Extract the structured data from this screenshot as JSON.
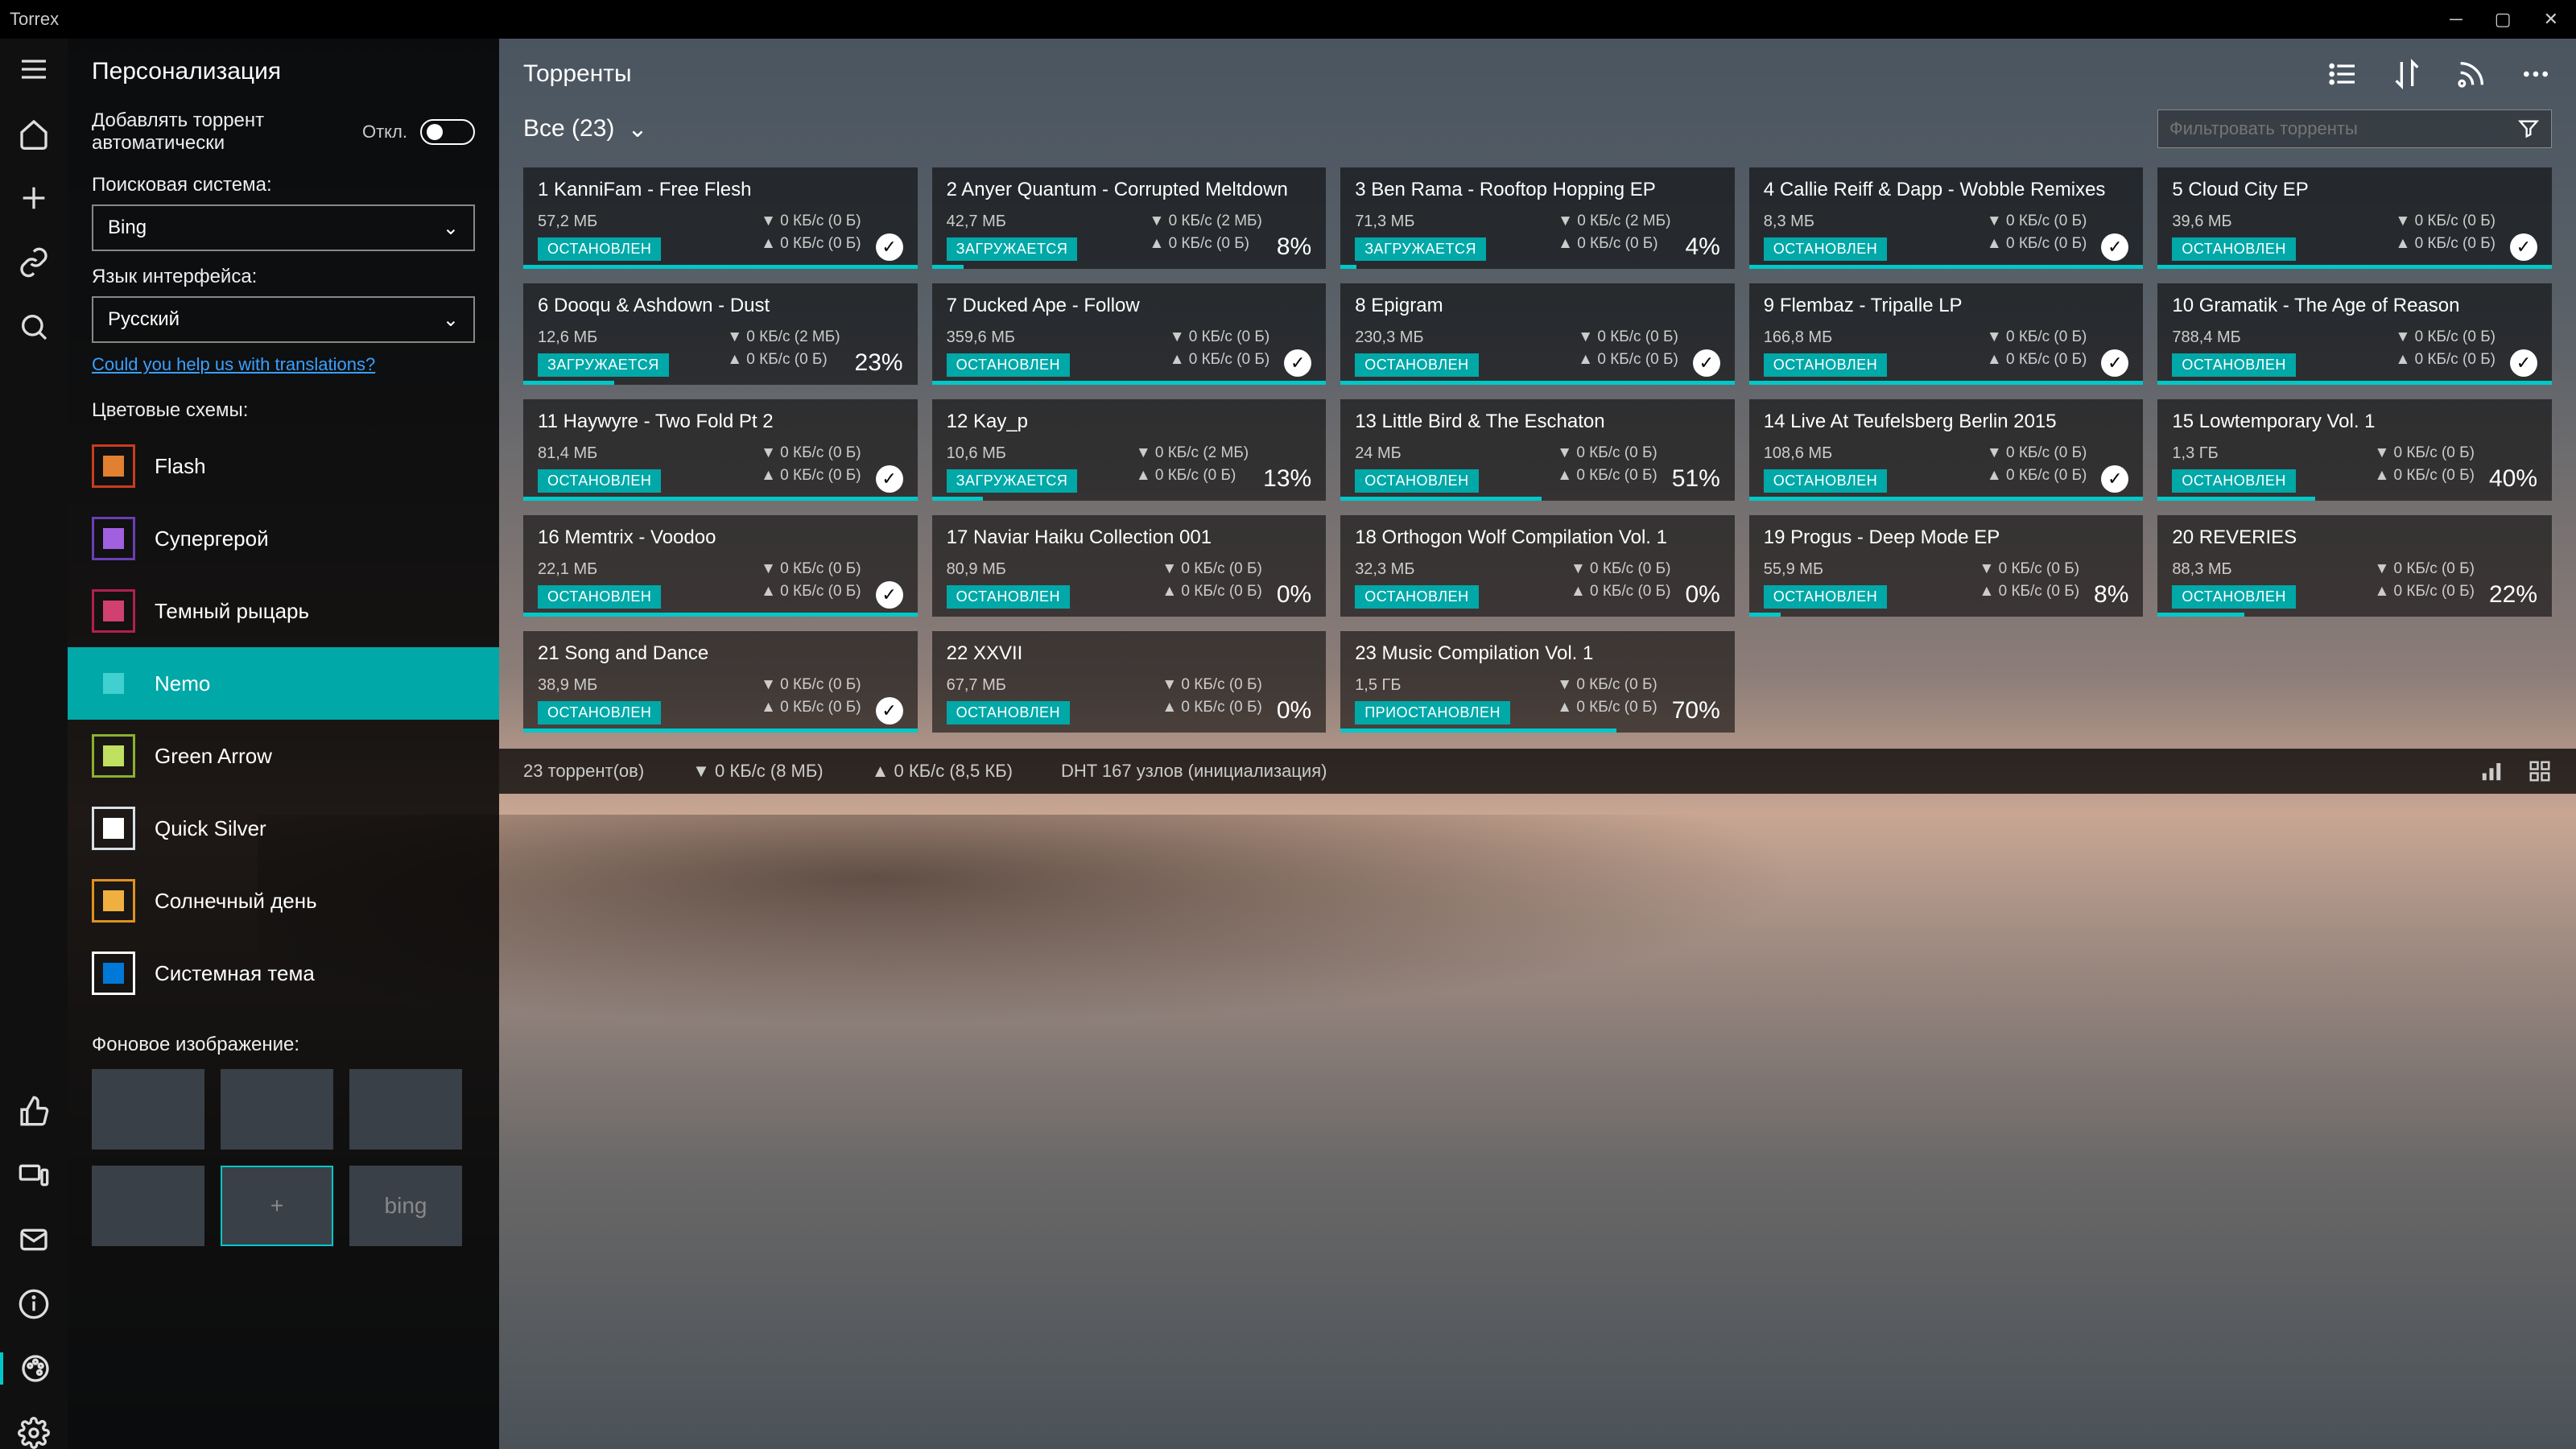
{
  "app_title": "Torrex",
  "sidebar": {
    "title": "Персонализация",
    "auto_add_label": "Добавлять торрент автоматически",
    "auto_add_state": "Откл.",
    "search_engine_label": "Поисковая система:",
    "search_engine_value": "Bing",
    "lang_label": "Язык интерфейса:",
    "lang_value": "Русский",
    "translate_link": "Could you help us with translations?",
    "themes_label": "Цветовые схемы:",
    "themes": [
      {
        "name": "Flash",
        "outer": "#c83c1e",
        "inner": "#e08030"
      },
      {
        "name": "Супергерой",
        "outer": "#6a3fb5",
        "inner": "#a060e0"
      },
      {
        "name": "Темный рыцарь",
        "outer": "#b02050",
        "inner": "#d04070"
      },
      {
        "name": "Nemo",
        "outer": "#00a8a8",
        "inner": "#40d0d0",
        "selected": true
      },
      {
        "name": "Green Arrow",
        "outer": "#8ab030",
        "inner": "#c0e060"
      },
      {
        "name": "Quick Silver",
        "outer": "#d8e0e8",
        "inner": "#ffffff"
      },
      {
        "name": "Солнечный день",
        "outer": "#e09020",
        "inner": "#f0b040"
      },
      {
        "name": "Системная тема",
        "outer": "#ffffff",
        "inner": "#0078d7"
      }
    ],
    "bg_label": "Фоновое изображение:",
    "bg_tiles": [
      "",
      "",
      "",
      "",
      "+",
      "bing"
    ],
    "bg_selected_index": 4
  },
  "content": {
    "title": "Торренты",
    "filter_label": "Все (23)",
    "search_placeholder": "Фильтровать торренты"
  },
  "status_labels": {
    "stopped": "ОСТАНОВЛЕН",
    "downloading": "ЗАГРУЖАЕТСЯ",
    "paused": "ПРИОСТАНОВЛЕН"
  },
  "torrents": [
    {
      "n": 1,
      "name": "KanniFam - Free Flesh",
      "size": "57,2 МБ",
      "status": "stopped",
      "down": "0 КБ/с (0 Б)",
      "up": "0 КБ/с (0 Б)",
      "done": true,
      "pct": null,
      "bar": 100
    },
    {
      "n": 2,
      "name": "Anyer Quantum - Corrupted Meltdown",
      "size": "42,7 МБ",
      "status": "downloading",
      "down": "0 КБ/с (2 МБ)",
      "up": "0 КБ/с (0 Б)",
      "pct": "8%",
      "bar": 8
    },
    {
      "n": 3,
      "name": "Ben Rama - Rooftop Hopping EP",
      "size": "71,3 МБ",
      "status": "downloading",
      "down": "0 КБ/с (2 МБ)",
      "up": "0 КБ/с (0 Б)",
      "pct": "4%",
      "bar": 4
    },
    {
      "n": 4,
      "name": "Callie Reiff & Dapp - Wobble Remixes",
      "size": "8,3 МБ",
      "status": "stopped",
      "down": "0 КБ/с (0 Б)",
      "up": "0 КБ/с (0 Б)",
      "done": true,
      "pct": null,
      "bar": 100
    },
    {
      "n": 5,
      "name": "Cloud City EP",
      "size": "39,6 МБ",
      "status": "stopped",
      "down": "0 КБ/с (0 Б)",
      "up": "0 КБ/с (0 Б)",
      "done": true,
      "pct": null,
      "bar": 100
    },
    {
      "n": 6,
      "name": "Dooqu & Ashdown - Dust",
      "size": "12,6 МБ",
      "status": "downloading",
      "down": "0 КБ/с (2 МБ)",
      "up": "0 КБ/с (0 Б)",
      "pct": "23%",
      "bar": 23
    },
    {
      "n": 7,
      "name": "Ducked Ape - Follow",
      "size": "359,6 МБ",
      "status": "stopped",
      "down": "0 КБ/с (0 Б)",
      "up": "0 КБ/с (0 Б)",
      "done": true,
      "pct": null,
      "bar": 100
    },
    {
      "n": 8,
      "name": "Epigram",
      "size": "230,3 МБ",
      "status": "stopped",
      "down": "0 КБ/с (0 Б)",
      "up": "0 КБ/с (0 Б)",
      "done": true,
      "pct": null,
      "bar": 100
    },
    {
      "n": 9,
      "name": "Flembaz - Tripalle LP",
      "size": "166,8 МБ",
      "status": "stopped",
      "down": "0 КБ/с (0 Б)",
      "up": "0 КБ/с (0 Б)",
      "done": true,
      "pct": null,
      "bar": 100
    },
    {
      "n": 10,
      "name": "Gramatik - The Age of Reason",
      "size": "788,4 МБ",
      "status": "stopped",
      "down": "0 КБ/с (0 Б)",
      "up": "0 КБ/с (0 Б)",
      "done": true,
      "pct": null,
      "bar": 100
    },
    {
      "n": 11,
      "name": "Haywyre - Two Fold Pt 2",
      "size": "81,4 МБ",
      "status": "stopped",
      "down": "0 КБ/с (0 Б)",
      "up": "0 КБ/с (0 Б)",
      "done": true,
      "pct": null,
      "bar": 100
    },
    {
      "n": 12,
      "name": "Kay_p",
      "size": "10,6 МБ",
      "status": "downloading",
      "down": "0 КБ/с (2 МБ)",
      "up": "0 КБ/с (0 Б)",
      "pct": "13%",
      "bar": 13
    },
    {
      "n": 13,
      "name": "Little Bird & The Eschaton",
      "size": "24 МБ",
      "status": "stopped",
      "down": "0 КБ/с (0 Б)",
      "up": "0 КБ/с (0 Б)",
      "pct": "51%",
      "bar": 51
    },
    {
      "n": 14,
      "name": "Live At Teufelsberg Berlin 2015",
      "size": "108,6 МБ",
      "status": "stopped",
      "down": "0 КБ/с (0 Б)",
      "up": "0 КБ/с (0 Б)",
      "done": true,
      "pct": null,
      "bar": 100
    },
    {
      "n": 15,
      "name": "Lowtemporary Vol. 1",
      "size": "1,3 ГБ",
      "status": "stopped",
      "down": "0 КБ/с (0 Б)",
      "up": "0 КБ/с (0 Б)",
      "pct": "40%",
      "bar": 40
    },
    {
      "n": 16,
      "name": "Memtrix - Voodoo",
      "size": "22,1 МБ",
      "status": "stopped",
      "down": "0 КБ/с (0 Б)",
      "up": "0 КБ/с (0 Б)",
      "done": true,
      "pct": null,
      "bar": 100
    },
    {
      "n": 17,
      "name": "Naviar Haiku Collection 001",
      "size": "80,9 МБ",
      "status": "stopped",
      "down": "0 КБ/с (0 Б)",
      "up": "0 КБ/с (0 Б)",
      "pct": "0%",
      "bar": 0
    },
    {
      "n": 18,
      "name": "Orthogon Wolf Compilation Vol. 1",
      "size": "32,3 МБ",
      "status": "stopped",
      "down": "0 КБ/с (0 Б)",
      "up": "0 КБ/с (0 Б)",
      "pct": "0%",
      "bar": 0
    },
    {
      "n": 19,
      "name": "Progus - Deep Mode EP",
      "size": "55,9 МБ",
      "status": "stopped",
      "down": "0 КБ/с (0 Б)",
      "up": "0 КБ/с (0 Б)",
      "pct": "8%",
      "bar": 8
    },
    {
      "n": 20,
      "name": "REVERIES",
      "size": "88,3 МБ",
      "status": "stopped",
      "down": "0 КБ/с (0 Б)",
      "up": "0 КБ/с (0 Б)",
      "pct": "22%",
      "bar": 22
    },
    {
      "n": 21,
      "name": "Song and Dance",
      "size": "38,9 МБ",
      "status": "stopped",
      "down": "0 КБ/с (0 Б)",
      "up": "0 КБ/с (0 Б)",
      "done": true,
      "pct": null,
      "bar": 100
    },
    {
      "n": 22,
      "name": "XXVII",
      "size": "67,7 МБ",
      "status": "stopped",
      "down": "0 КБ/с (0 Б)",
      "up": "0 КБ/с (0 Б)",
      "pct": "0%",
      "bar": 0
    },
    {
      "n": 23,
      "name": "Music Compilation Vol. 1",
      "size": "1,5 ГБ",
      "status": "paused",
      "down": "0 КБ/с (0 Б)",
      "up": "0 КБ/с (0 Б)",
      "pct": "70%",
      "bar": 70
    }
  ],
  "statusbar": {
    "count": "23 торрент(ов)",
    "down": "0 КБ/с (8 МБ)",
    "up": "0 КБ/с (8,5 КБ)",
    "dht": "DHT 167 узлов (инициализация)"
  }
}
